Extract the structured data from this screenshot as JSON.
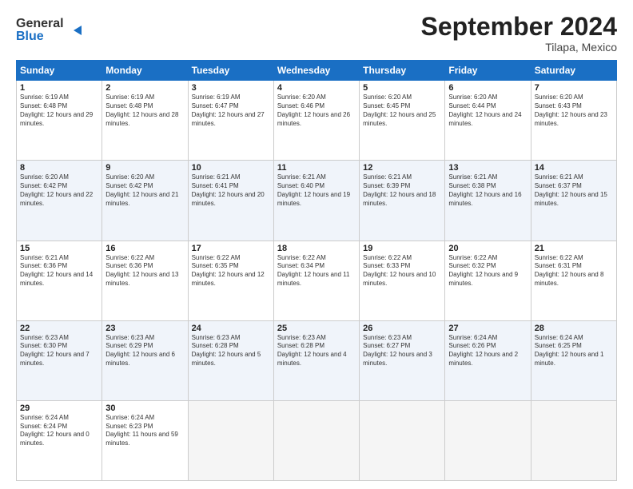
{
  "header": {
    "logo_line1": "General",
    "logo_line2": "Blue",
    "month": "September 2024",
    "location": "Tilapa, Mexico"
  },
  "days_of_week": [
    "Sunday",
    "Monday",
    "Tuesday",
    "Wednesday",
    "Thursday",
    "Friday",
    "Saturday"
  ],
  "weeks": [
    [
      {
        "day": "1",
        "sunrise": "6:19 AM",
        "sunset": "6:48 PM",
        "daylight": "12 hours and 29 minutes."
      },
      {
        "day": "2",
        "sunrise": "6:19 AM",
        "sunset": "6:48 PM",
        "daylight": "12 hours and 28 minutes."
      },
      {
        "day": "3",
        "sunrise": "6:19 AM",
        "sunset": "6:47 PM",
        "daylight": "12 hours and 27 minutes."
      },
      {
        "day": "4",
        "sunrise": "6:20 AM",
        "sunset": "6:46 PM",
        "daylight": "12 hours and 26 minutes."
      },
      {
        "day": "5",
        "sunrise": "6:20 AM",
        "sunset": "6:45 PM",
        "daylight": "12 hours and 25 minutes."
      },
      {
        "day": "6",
        "sunrise": "6:20 AM",
        "sunset": "6:44 PM",
        "daylight": "12 hours and 24 minutes."
      },
      {
        "day": "7",
        "sunrise": "6:20 AM",
        "sunset": "6:43 PM",
        "daylight": "12 hours and 23 minutes."
      }
    ],
    [
      {
        "day": "8",
        "sunrise": "6:20 AM",
        "sunset": "6:42 PM",
        "daylight": "12 hours and 22 minutes."
      },
      {
        "day": "9",
        "sunrise": "6:20 AM",
        "sunset": "6:42 PM",
        "daylight": "12 hours and 21 minutes."
      },
      {
        "day": "10",
        "sunrise": "6:21 AM",
        "sunset": "6:41 PM",
        "daylight": "12 hours and 20 minutes."
      },
      {
        "day": "11",
        "sunrise": "6:21 AM",
        "sunset": "6:40 PM",
        "daylight": "12 hours and 19 minutes."
      },
      {
        "day": "12",
        "sunrise": "6:21 AM",
        "sunset": "6:39 PM",
        "daylight": "12 hours and 18 minutes."
      },
      {
        "day": "13",
        "sunrise": "6:21 AM",
        "sunset": "6:38 PM",
        "daylight": "12 hours and 16 minutes."
      },
      {
        "day": "14",
        "sunrise": "6:21 AM",
        "sunset": "6:37 PM",
        "daylight": "12 hours and 15 minutes."
      }
    ],
    [
      {
        "day": "15",
        "sunrise": "6:21 AM",
        "sunset": "6:36 PM",
        "daylight": "12 hours and 14 minutes."
      },
      {
        "day": "16",
        "sunrise": "6:22 AM",
        "sunset": "6:36 PM",
        "daylight": "12 hours and 13 minutes."
      },
      {
        "day": "17",
        "sunrise": "6:22 AM",
        "sunset": "6:35 PM",
        "daylight": "12 hours and 12 minutes."
      },
      {
        "day": "18",
        "sunrise": "6:22 AM",
        "sunset": "6:34 PM",
        "daylight": "12 hours and 11 minutes."
      },
      {
        "day": "19",
        "sunrise": "6:22 AM",
        "sunset": "6:33 PM",
        "daylight": "12 hours and 10 minutes."
      },
      {
        "day": "20",
        "sunrise": "6:22 AM",
        "sunset": "6:32 PM",
        "daylight": "12 hours and 9 minutes."
      },
      {
        "day": "21",
        "sunrise": "6:22 AM",
        "sunset": "6:31 PM",
        "daylight": "12 hours and 8 minutes."
      }
    ],
    [
      {
        "day": "22",
        "sunrise": "6:23 AM",
        "sunset": "6:30 PM",
        "daylight": "12 hours and 7 minutes."
      },
      {
        "day": "23",
        "sunrise": "6:23 AM",
        "sunset": "6:29 PM",
        "daylight": "12 hours and 6 minutes."
      },
      {
        "day": "24",
        "sunrise": "6:23 AM",
        "sunset": "6:28 PM",
        "daylight": "12 hours and 5 minutes."
      },
      {
        "day": "25",
        "sunrise": "6:23 AM",
        "sunset": "6:28 PM",
        "daylight": "12 hours and 4 minutes."
      },
      {
        "day": "26",
        "sunrise": "6:23 AM",
        "sunset": "6:27 PM",
        "daylight": "12 hours and 3 minutes."
      },
      {
        "day": "27",
        "sunrise": "6:24 AM",
        "sunset": "6:26 PM",
        "daylight": "12 hours and 2 minutes."
      },
      {
        "day": "28",
        "sunrise": "6:24 AM",
        "sunset": "6:25 PM",
        "daylight": "12 hours and 1 minute."
      }
    ],
    [
      {
        "day": "29",
        "sunrise": "6:24 AM",
        "sunset": "6:24 PM",
        "daylight": "12 hours and 0 minutes."
      },
      {
        "day": "30",
        "sunrise": "6:24 AM",
        "sunset": "6:23 PM",
        "daylight": "11 hours and 59 minutes."
      },
      null,
      null,
      null,
      null,
      null
    ]
  ]
}
